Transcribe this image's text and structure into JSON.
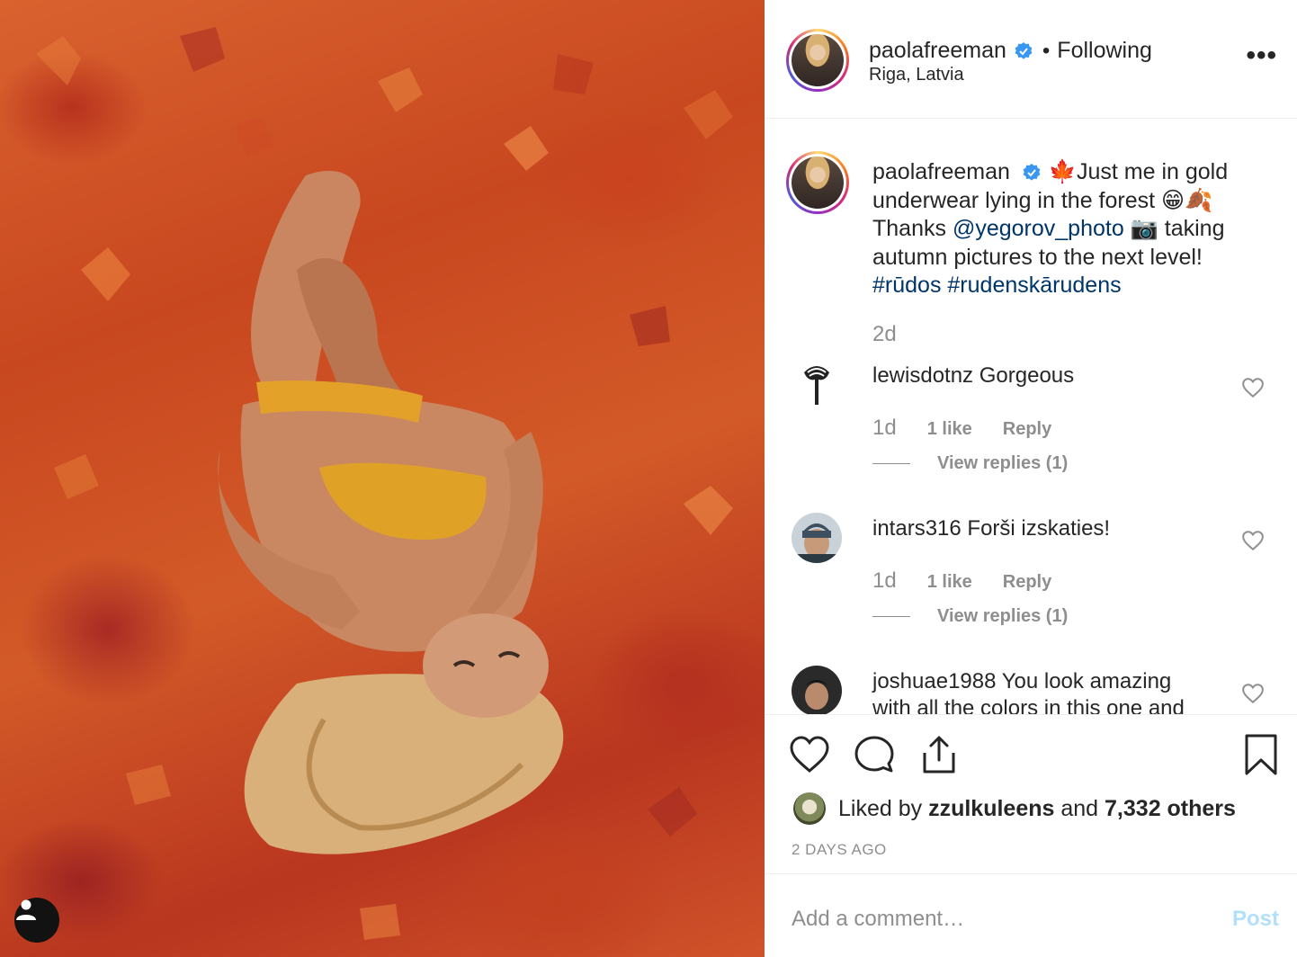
{
  "post": {
    "username": "paolafreeman",
    "follow_status": "Following",
    "separator": "•",
    "location": "Riga, Latvia",
    "more_label": "•••"
  },
  "caption": {
    "username": "paolafreeman",
    "emoji_leaf": "🍁",
    "line1": "Just me in gold",
    "line2": "underwear lying in the forest",
    "emoji_grin": "😁",
    "emoji_fallen": "🍂",
    "line3_pre": "Thanks ",
    "mention": "@yegorov_photo",
    "emoji_camera": "📷",
    "line3_post": " taking",
    "line4": "autumn pictures to the next level!",
    "hashtag1": "#rūdos",
    "hashtag2": "#rudenskārudens",
    "time": "2d"
  },
  "comments": [
    {
      "username": "lewisdotnz",
      "text": "Gorgeous",
      "ago": "1d",
      "likes": "1 like",
      "reply": "Reply",
      "view_replies": "View replies (1)"
    },
    {
      "username": "intars316",
      "text": "Forši izskaties!",
      "ago": "1d",
      "likes": "1 like",
      "reply": "Reply",
      "view_replies": "View replies (1)"
    },
    {
      "username": "joshuae1988",
      "text": "You look amazing",
      "text_cont": "with all the colors in this one and"
    }
  ],
  "likes": {
    "prefix": "Liked by ",
    "user": "zzulkuleens",
    "middle": " and ",
    "others": "7,332 others"
  },
  "date": "2 DAYS AGO",
  "add_comment": {
    "placeholder": "Add a comment…",
    "post_label": "Post"
  },
  "colors": {
    "link": "#003569",
    "muted": "#8e8e8e",
    "verified": "#3897f0",
    "post_disabled": "#b2dffc"
  }
}
